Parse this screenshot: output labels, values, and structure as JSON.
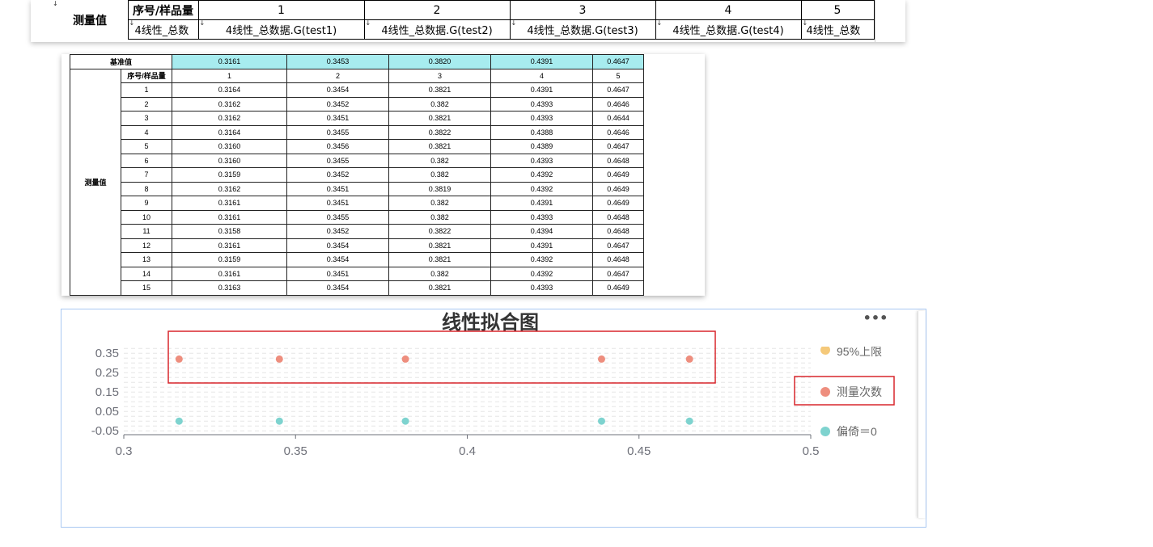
{
  "design_grid": {
    "measure_label": "测量值",
    "header_label": "序号/样品量",
    "columns": [
      "1",
      "2",
      "3",
      "4",
      "5"
    ],
    "bind_first": "4线性_总数",
    "bindings": [
      "4线性_总数据.G(test1)",
      "4线性_总数据.G(test2)",
      "4线性_总数据.G(test3)",
      "4线性_总数据.G(test4)",
      "4线性_总数"
    ],
    "marker": "↓"
  },
  "preview_table": {
    "reference_label": "基准值",
    "reference_values": [
      "0.3161",
      "0.3453",
      "0.3820",
      "0.4391",
      "0.4647"
    ],
    "measure_label": "测量值",
    "header_label": "序号/样品量",
    "columns": [
      "1",
      "2",
      "3",
      "4",
      "5"
    ],
    "rows": [
      [
        "1",
        "0.3164",
        "0.3454",
        "0.3821",
        "0.4391",
        "0.4647"
      ],
      [
        "2",
        "0.3162",
        "0.3452",
        "0.382",
        "0.4393",
        "0.4646"
      ],
      [
        "3",
        "0.3162",
        "0.3451",
        "0.3821",
        "0.4393",
        "0.4644"
      ],
      [
        "4",
        "0.3164",
        "0.3455",
        "0.3822",
        "0.4388",
        "0.4646"
      ],
      [
        "5",
        "0.3160",
        "0.3456",
        "0.3821",
        "0.4389",
        "0.4647"
      ],
      [
        "6",
        "0.3160",
        "0.3455",
        "0.382",
        "0.4393",
        "0.4648"
      ],
      [
        "7",
        "0.3159",
        "0.3452",
        "0.382",
        "0.4392",
        "0.4649"
      ],
      [
        "8",
        "0.3162",
        "0.3451",
        "0.3819",
        "0.4392",
        "0.4649"
      ],
      [
        "9",
        "0.3161",
        "0.3451",
        "0.382",
        "0.4391",
        "0.4649"
      ],
      [
        "10",
        "0.3161",
        "0.3455",
        "0.382",
        "0.4393",
        "0.4648"
      ],
      [
        "11",
        "0.3158",
        "0.3452",
        "0.3822",
        "0.4394",
        "0.4648"
      ],
      [
        "12",
        "0.3161",
        "0.3454",
        "0.3821",
        "0.4391",
        "0.4647"
      ],
      [
        "13",
        "0.3159",
        "0.3454",
        "0.3821",
        "0.4392",
        "0.4648"
      ],
      [
        "14",
        "0.3161",
        "0.3451",
        "0.382",
        "0.4392",
        "0.4647"
      ],
      [
        "15",
        "0.3163",
        "0.3454",
        "0.3821",
        "0.4393",
        "0.4649"
      ]
    ]
  },
  "chart_data": {
    "type": "scatter",
    "title": "线性拟合图",
    "xlim": [
      0.3,
      0.5
    ],
    "x_ticks": [
      "0.3",
      "0.35",
      "0.4",
      "0.45",
      "0.5"
    ],
    "y_ticks": [
      "0.35",
      "0.25",
      "0.15",
      "0.05",
      "-0.05"
    ],
    "y_tick_values": [
      0.35,
      0.25,
      0.15,
      0.05,
      -0.05
    ],
    "grid": true,
    "legend_position": "right",
    "series": [
      {
        "name": "测量次数",
        "color": "#ee8e7e",
        "x": [
          0.3161,
          0.3453,
          0.382,
          0.4391,
          0.4647
        ],
        "y": [
          0.32,
          0.32,
          0.32,
          0.32,
          0.32
        ]
      },
      {
        "name": "偏倚＝0",
        "color": "#7ed3cf",
        "x": [
          0.3161,
          0.3453,
          0.382,
          0.4391,
          0.4647
        ],
        "y": [
          0,
          0,
          0,
          0,
          0
        ]
      }
    ],
    "legend_partial": {
      "text": "95%上限",
      "color": "#f5c97a"
    },
    "more_label": "•••"
  },
  "colors": {
    "highlight_box": "#d9262c",
    "header_cyan": "#a7ecef",
    "chart_border": "#a9c8f2"
  }
}
